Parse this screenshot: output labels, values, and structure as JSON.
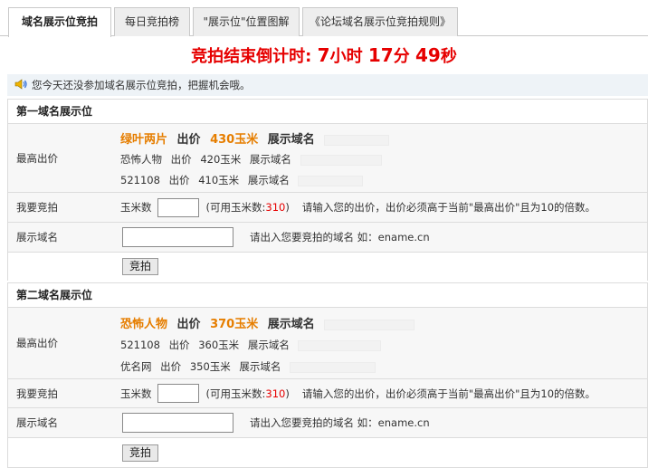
{
  "tabs": [
    {
      "label": "域名展示位竞拍",
      "active": true
    },
    {
      "label": "每日竞拍榜",
      "active": false
    },
    {
      "label": "\"展示位\"位置图解",
      "active": false
    },
    {
      "label": "《论坛域名展示位竞拍规则》",
      "active": false
    }
  ],
  "countdown": {
    "prefix": "竞拍结束倒计时:",
    "hours": "7",
    "hours_unit": "小时",
    "minutes": "17",
    "minutes_unit": "分",
    "seconds": "49",
    "seconds_unit": "秒"
  },
  "notice": "您今天还没参加域名展示位竞拍，把握机会哦。",
  "sections": [
    {
      "title": "第一域名展示位",
      "highest_label": "最高出价",
      "top_bid": {
        "bidder": "绿叶两片",
        "price_label": "出价",
        "price": "430玉米",
        "domain_label": "展示域名"
      },
      "bids": [
        {
          "bidder": "恐怖人物",
          "price_label": "出价",
          "price": "420玉米",
          "domain_label": "展示域名"
        },
        {
          "bidder": "521108",
          "price_label": "出价",
          "price": "410玉米",
          "domain_label": "展示域名"
        }
      ],
      "my_bid_label": "我要竞拍",
      "corn_label": "玉米数",
      "available_prefix": "(可用玉米数:",
      "available_value": "310",
      "available_suffix": ")",
      "bid_hint": "请输入您的出价，出价必须高于当前\"最高出价\"且为10的倍数。",
      "domain_row_label": "展示域名",
      "domain_hint": "请出入您要竞拍的域名 如：ename.cn",
      "bid_button": "竞拍"
    },
    {
      "title": "第二域名展示位",
      "highest_label": "最高出价",
      "top_bid": {
        "bidder": "恐怖人物",
        "price_label": "出价",
        "price": "370玉米",
        "domain_label": "展示域名"
      },
      "bids": [
        {
          "bidder": "521108",
          "price_label": "出价",
          "price": "360玉米",
          "domain_label": "展示域名"
        },
        {
          "bidder": "优名网",
          "price_label": "出价",
          "price": "350玉米",
          "domain_label": "展示域名"
        }
      ],
      "my_bid_label": "我要竞拍",
      "corn_label": "玉米数",
      "available_prefix": "(可用玉米数:",
      "available_value": "310",
      "available_suffix": ")",
      "bid_hint": "请输入您的出价，出价必须高于当前\"最高出价\"且为10的倍数。",
      "domain_row_label": "展示域名",
      "domain_hint": "请出入您要竞拍的域名 如：ename.cn",
      "bid_button": "竞拍"
    }
  ],
  "colors": {
    "countdown": "#e60000",
    "highlight": "#e67e00",
    "available": "#e60000"
  },
  "icons": {
    "notice": "speaker-icon"
  }
}
